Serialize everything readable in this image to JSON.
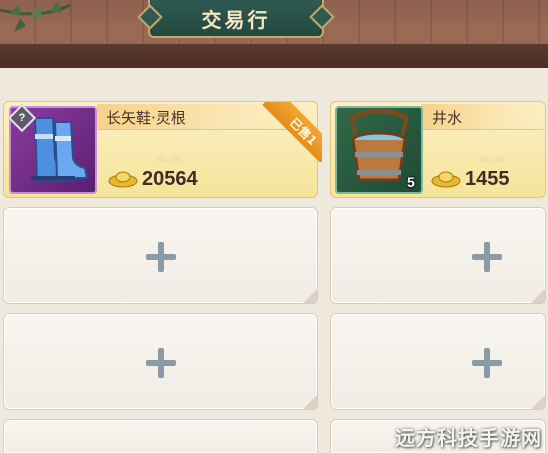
{
  "header": {
    "title": "交易行"
  },
  "listings": [
    {
      "name": "长矢鞋·灵根",
      "price": "20564",
      "badge": "已售1",
      "help_badge": "?",
      "icon": "boots-icon",
      "currency_icon": "gold-ingot-icon"
    },
    {
      "name": "井水",
      "price": "1455",
      "quantity": "5",
      "icon": "water-bucket-icon",
      "currency_icon": "gold-ingot-icon"
    }
  ],
  "empty_slot_icon": "plus-icon",
  "watermark": "远方科技手游网",
  "colors": {
    "header_plaque": "#2f5a52",
    "plaque_border": "#c6a96a",
    "card_gold": "#f5e49a",
    "ribbon_orange": "#e58c1c",
    "empty_card": "#f4f0ea",
    "plus_icon": "#8a9aa6"
  }
}
